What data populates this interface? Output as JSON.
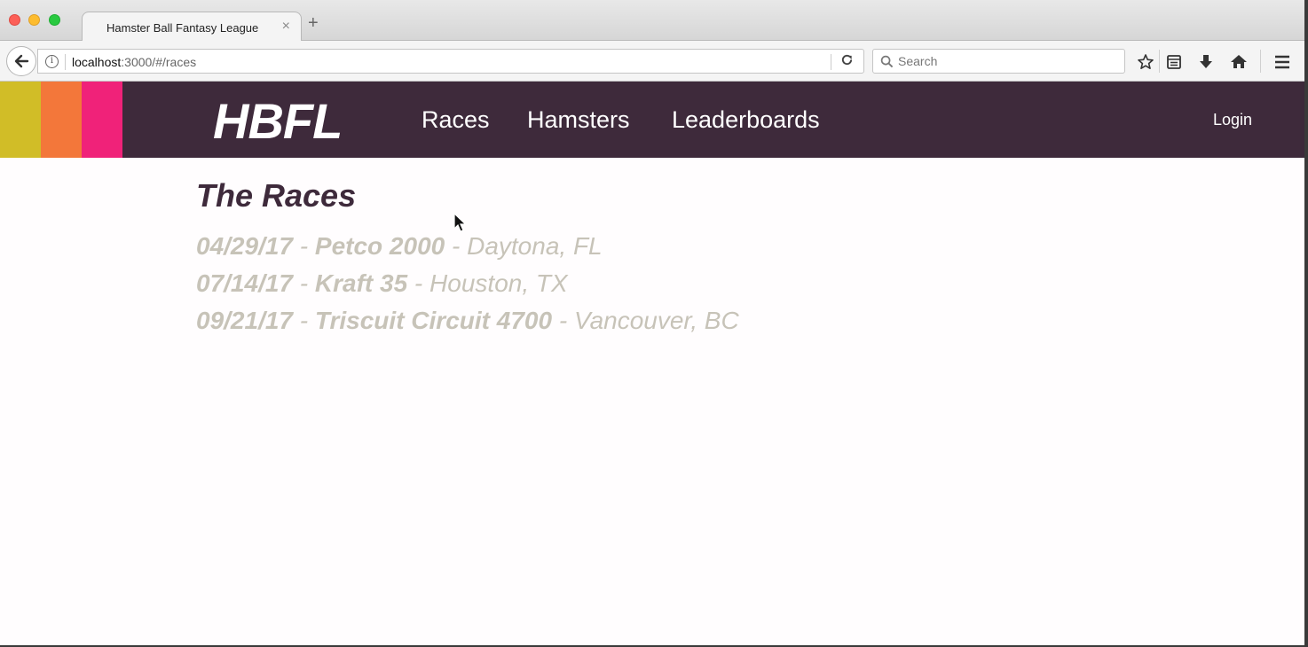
{
  "browser": {
    "tab_title": "Hamster Ball Fantasy League",
    "tab_close_glyph": "×",
    "new_tab_glyph": "+",
    "url_host": "localhost",
    "url_path": ":3000/#/races",
    "search_placeholder": "Search"
  },
  "colors": {
    "header_bg": "#3e2a3b",
    "stripe_yellow": "#d1bd27",
    "stripe_orange": "#f3773a",
    "stripe_pink": "#f02279",
    "race_text": "#c7c3b8"
  },
  "site": {
    "logo": "HBFL",
    "nav": [
      "Races",
      "Hamsters",
      "Leaderboards"
    ],
    "login": "Login"
  },
  "main": {
    "title": "The Races",
    "races": [
      {
        "date": "04/29/17",
        "name": "Petco 2000",
        "location": "Daytona, FL"
      },
      {
        "date": "07/14/17",
        "name": "Kraft 35",
        "location": "Houston, TX"
      },
      {
        "date": "09/21/17",
        "name": "Triscuit Circuit 4700",
        "location": "Vancouver, BC"
      }
    ],
    "separator": " - "
  }
}
